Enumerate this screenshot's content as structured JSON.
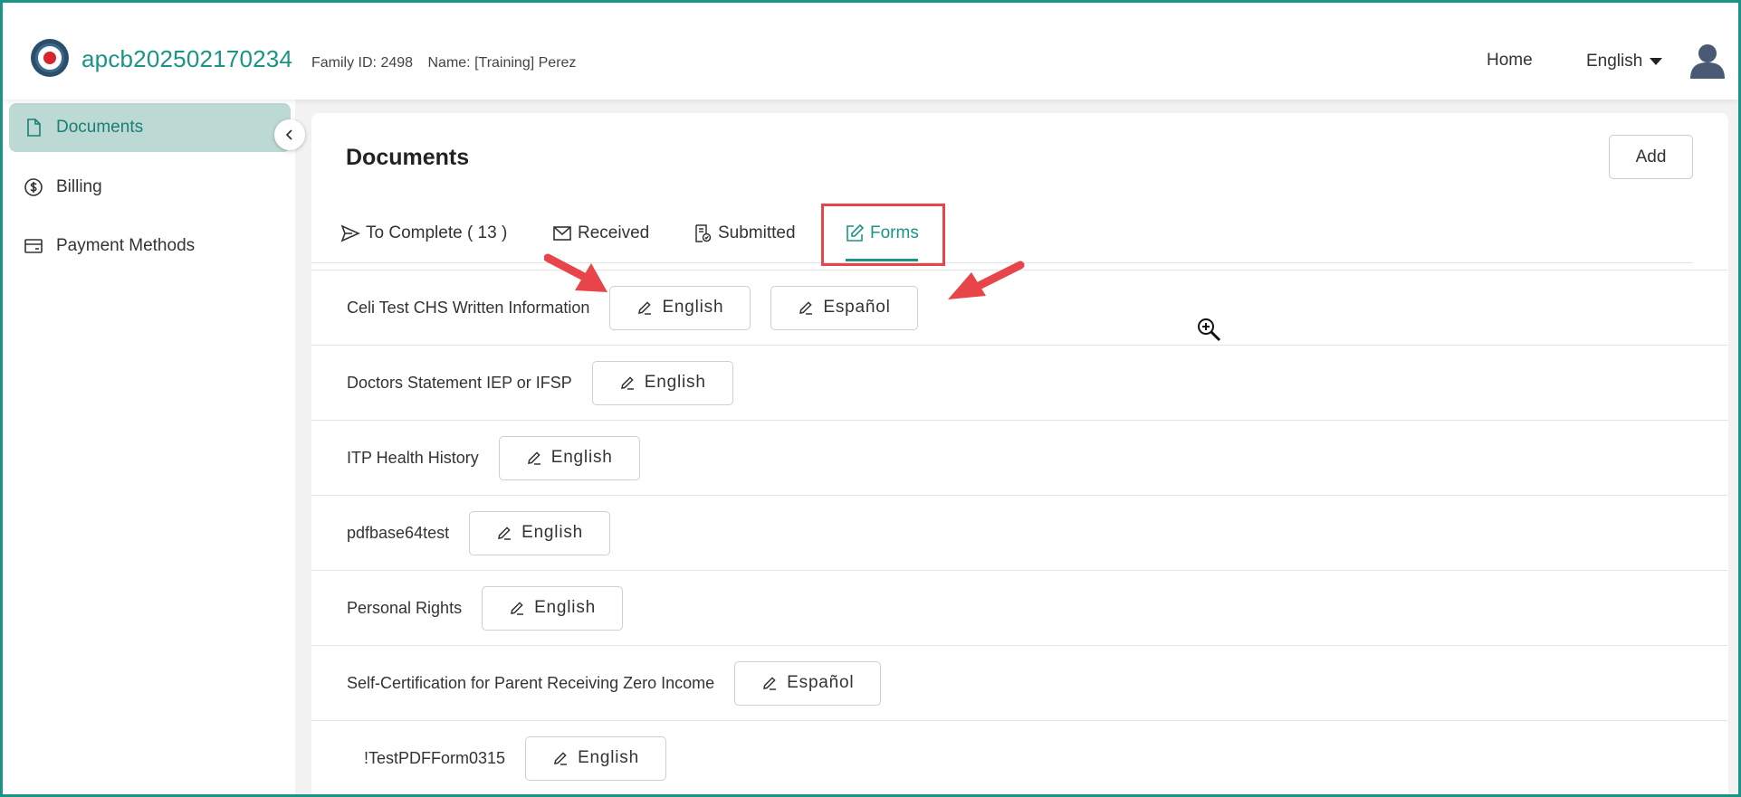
{
  "header": {
    "app_title": "apcb202502170234",
    "family_id": "Family ID: 2498",
    "name": "Name: [Training] Perez",
    "home_label": "Home",
    "language_label": "English"
  },
  "sidebar": {
    "items": [
      {
        "label": "Documents",
        "icon": "document-icon",
        "active": true
      },
      {
        "label": "Billing",
        "icon": "dollar-icon",
        "active": false
      },
      {
        "label": "Payment Methods",
        "icon": "card-icon",
        "active": false
      }
    ]
  },
  "main": {
    "title": "Documents",
    "add_label": "Add",
    "tabs": [
      {
        "label": "To Complete ( 13 )",
        "icon": "send-icon"
      },
      {
        "label": "Received",
        "icon": "mail-icon"
      },
      {
        "label": "Submitted",
        "icon": "submitted-doc-icon"
      },
      {
        "label": "Forms",
        "icon": "edit-icon",
        "active": true
      }
    ],
    "forms": [
      {
        "name": "Celi Test CHS Written Information",
        "buttons": [
          "English",
          "Español"
        ]
      },
      {
        "name": "Doctors Statement IEP or IFSP",
        "buttons": [
          "English"
        ]
      },
      {
        "name": "ITP Health History",
        "buttons": [
          "English"
        ]
      },
      {
        "name": "pdfbase64test",
        "buttons": [
          "English"
        ]
      },
      {
        "name": "Personal Rights",
        "buttons": [
          "English"
        ]
      },
      {
        "name": "Self-Certification for Parent Receiving Zero Income",
        "buttons": [
          "Español"
        ]
      },
      {
        "name": "!TestPDFForm0315",
        "buttons": [
          "English"
        ]
      }
    ]
  },
  "colors": {
    "accent": "#1a9484",
    "active_bg": "#bcd9d3",
    "annotation_red": "#e8454b"
  }
}
